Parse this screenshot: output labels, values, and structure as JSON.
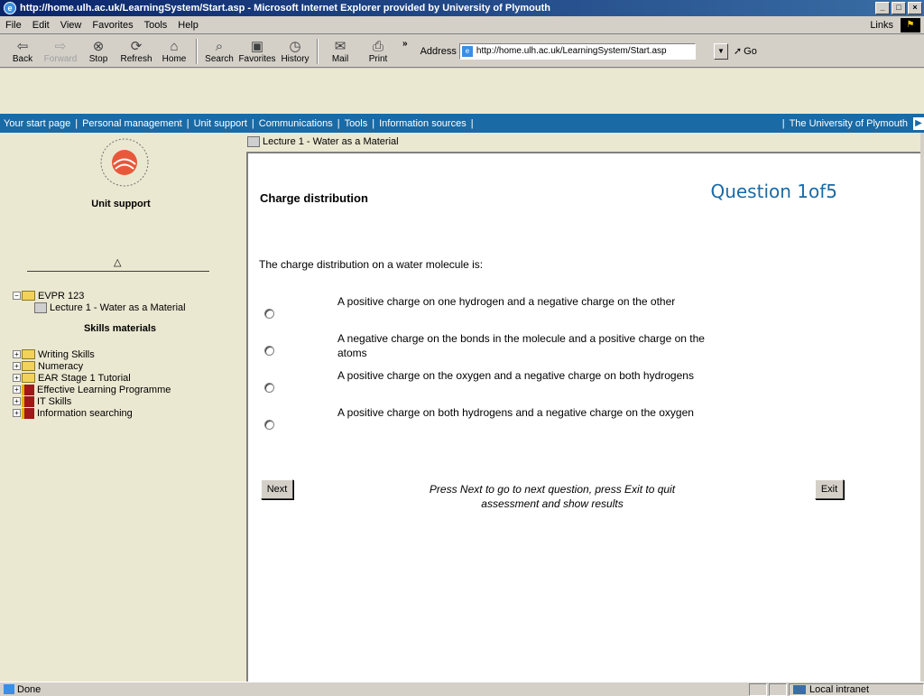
{
  "window": {
    "title": "http://home.ulh.ac.uk/LearningSystem/Start.asp - Microsoft Internet Explorer provided by University of Plymouth"
  },
  "menubar": {
    "items": [
      "File",
      "Edit",
      "View",
      "Favorites",
      "Tools",
      "Help"
    ],
    "links_label": "Links"
  },
  "toolbar": {
    "back": "Back",
    "forward": "Forward",
    "stop": "Stop",
    "refresh": "Refresh",
    "home": "Home",
    "search": "Search",
    "favorites": "Favorites",
    "history": "History",
    "mail": "Mail",
    "print": "Print",
    "more": "»",
    "address_label": "Address",
    "address_value": "http://home.ulh.ac.uk/LearningSystem/Start.asp",
    "go_label": "Go"
  },
  "sitenav": {
    "links": [
      "Your start page",
      "Personal management",
      "Unit support",
      "Communications",
      "Tools",
      "Information sources"
    ],
    "right_link": "The University of Plymouth"
  },
  "sidebar": {
    "title": "Unit support",
    "course": "EVPR 123",
    "lecture": "Lecture 1 - Water as a Material",
    "skills_title": "Skills materials",
    "skills": [
      {
        "label": "Writing Skills",
        "icon": "folder-icon"
      },
      {
        "label": "Numeracy",
        "icon": "folder-icon"
      },
      {
        "label": "EAR Stage 1 Tutorial",
        "icon": "folder-icon"
      },
      {
        "label": "Effective Learning Programme",
        "icon": "book-icon"
      },
      {
        "label": "IT Skills",
        "icon": "book-icon"
      },
      {
        "label": "Information searching",
        "icon": "book-icon"
      }
    ]
  },
  "main": {
    "breadcrumb": "Lecture 1 - Water as a Material",
    "heading": "Charge distribution",
    "question_counter": "Question 1of5",
    "question": "The charge distribution on a water molecule is:",
    "options": [
      "A positive charge on one hydrogen and a negative charge on the other",
      "A negative charge on the bonds in the molecule and a positive charge on the atoms",
      "A positive charge on the oxygen and a negative charge on both hydrogens",
      "A positive charge on both hydrogens and a negative charge on the oxygen"
    ],
    "next_label": "Next",
    "exit_label": "Exit",
    "instructions": "Press Next to go to next question, press Exit to quit assessment and show results"
  },
  "statusbar": {
    "status": "Done",
    "zone": "Local intranet"
  }
}
